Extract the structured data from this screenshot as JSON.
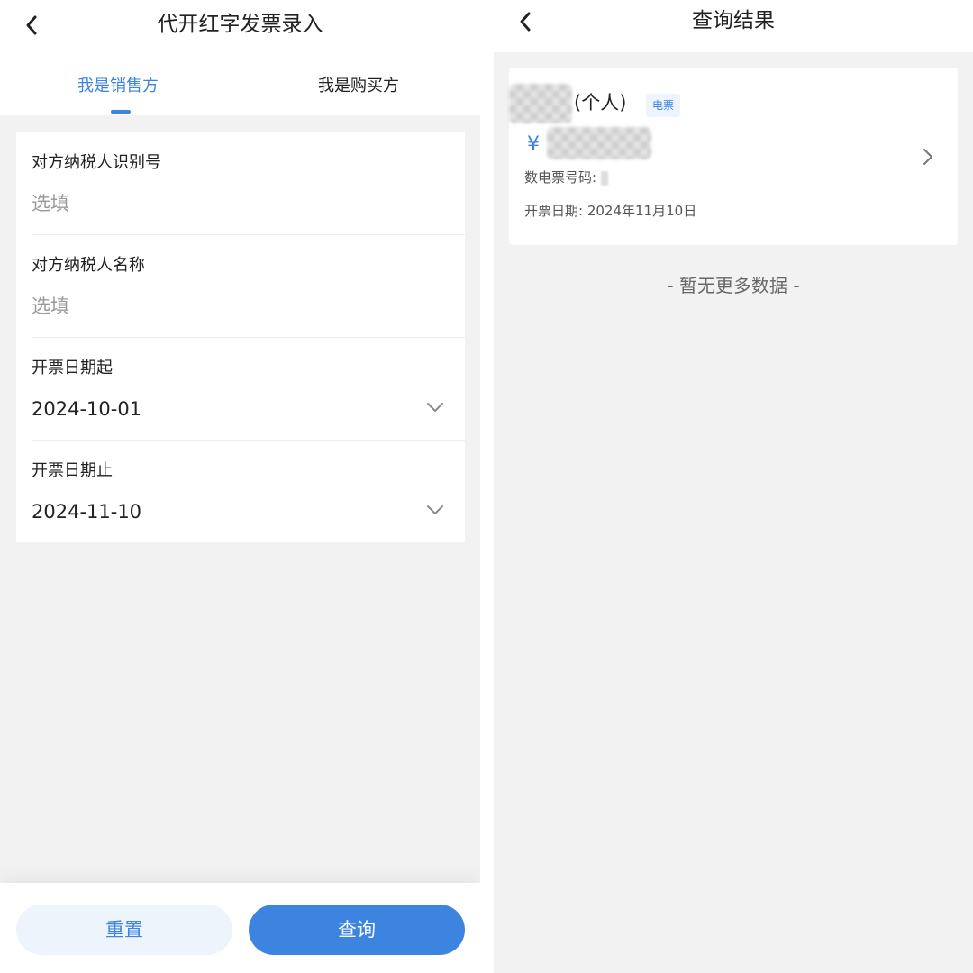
{
  "left_screen": {
    "title": "代开红字发票录入",
    "tabs": [
      {
        "label": "我是销售方",
        "active": true
      },
      {
        "label": "我是购买方",
        "active": false
      }
    ],
    "form": {
      "taxpayer_id": {
        "label": "对方纳税人识别号",
        "placeholder": "选填"
      },
      "taxpayer_name": {
        "label": "对方纳税人名称",
        "placeholder": "选填"
      },
      "start_date": {
        "label": "开票日期起",
        "value": "2024-10-01"
      },
      "end_date": {
        "label": "开票日期止",
        "value": "2024-11-10"
      }
    },
    "buttons": {
      "reset": "重置",
      "query": "查询"
    }
  },
  "right_screen": {
    "title": "查询结果",
    "result": {
      "name_suffix": "(个人)",
      "tag": "电票",
      "currency_symbol": "¥",
      "code_label": "数电票号码:",
      "date_label": "开票日期:",
      "date_value": "2024年11月10日"
    },
    "no_more": "- 暂无更多数据 -"
  },
  "colors": {
    "accent": "#3d84e0",
    "background": "#f2f2f2",
    "tag_background": "#eef4fc"
  },
  "icons": {
    "back": "chevron-left-icon",
    "dropdown": "chevron-down-icon",
    "detail": "chevron-right-icon"
  }
}
